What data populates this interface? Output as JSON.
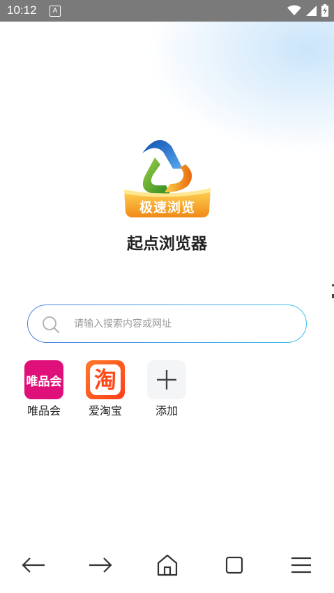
{
  "status_bar": {
    "time": "10:12",
    "notification_icon_label": "A",
    "icons": [
      "wifi-icon",
      "signal-icon",
      "battery-charging-icon"
    ]
  },
  "logo": {
    "text": "极速浏览",
    "colors": {
      "blue": "#1f6fd1",
      "green": "#4ea62a",
      "orange": "#f08a17",
      "banner": "#f2a424"
    }
  },
  "app": {
    "title": "起点浏览器"
  },
  "search": {
    "placeholder": "请输入搜索内容或网址",
    "value": ""
  },
  "shortcuts": [
    {
      "label": "唯品会",
      "tile_text": "唯品会",
      "color": "#e0107a"
    },
    {
      "label": "爱淘宝",
      "tile_text": "淘",
      "color": "#ff5a1f"
    },
    {
      "label": "添加",
      "icon": "plus-icon"
    }
  ],
  "bottom_nav": [
    "back-arrow-icon",
    "forward-arrow-icon",
    "home-icon",
    "tabs-icon",
    "menu-icon"
  ]
}
